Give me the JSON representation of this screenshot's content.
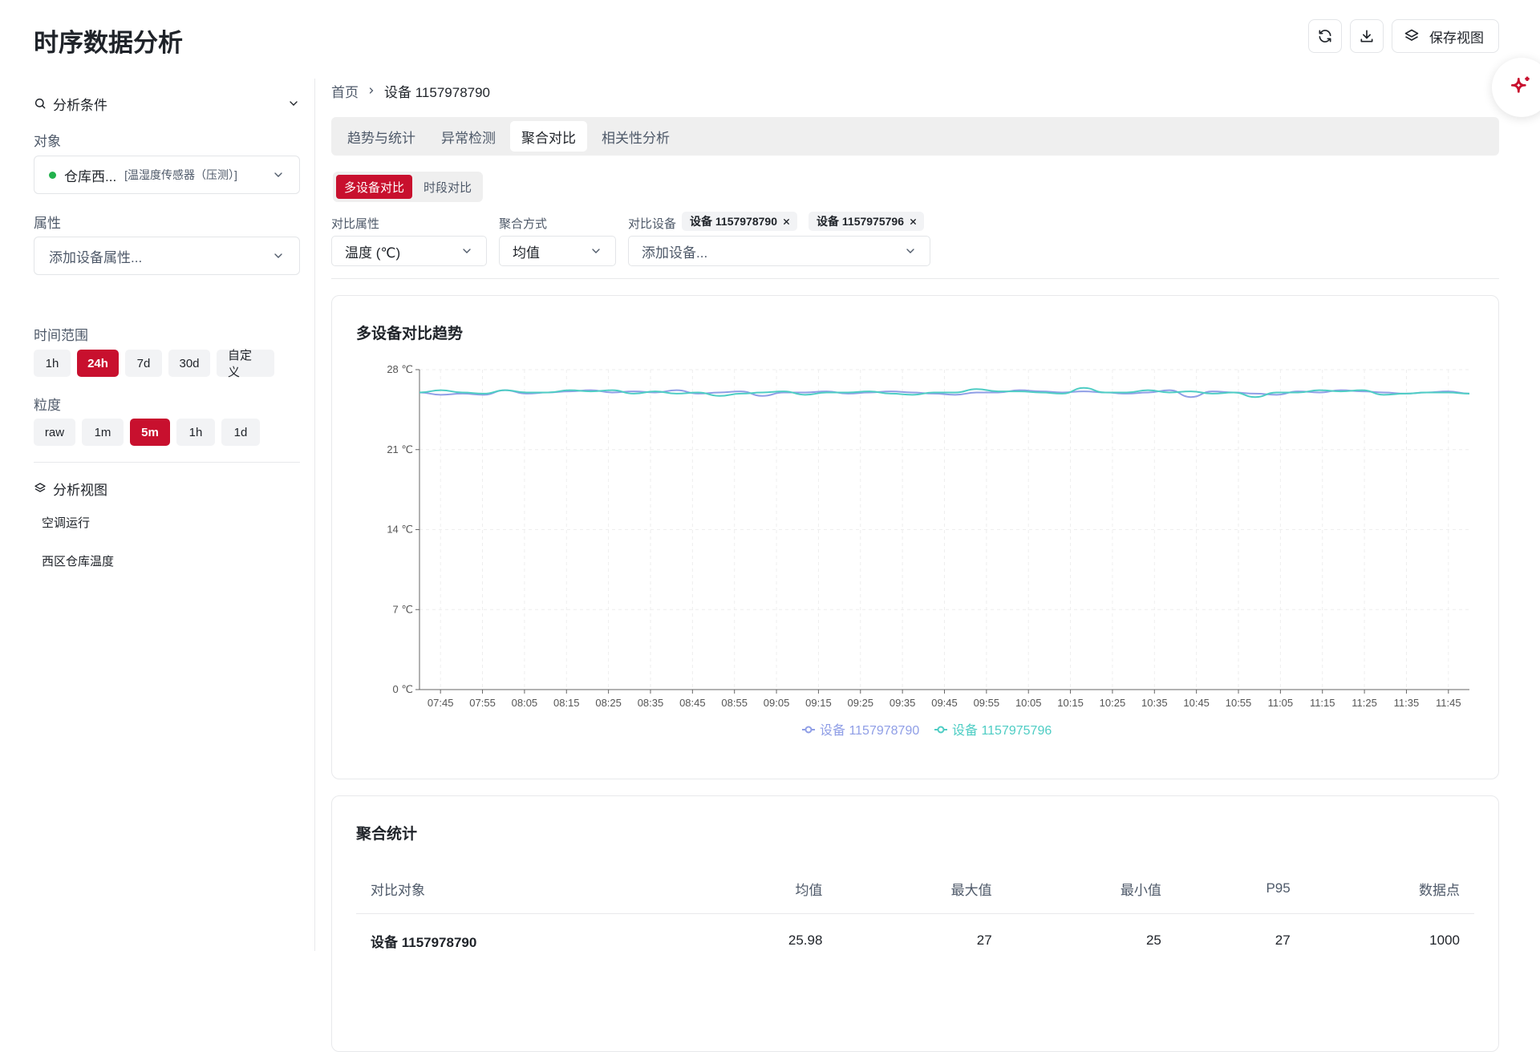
{
  "app": {
    "title": "时序数据分析"
  },
  "top_actions": {
    "save_view_label": "保存视图"
  },
  "sidebar": {
    "analysis_conditions_label": "分析条件",
    "object_label": "对象",
    "object_value": "仓库西...",
    "object_type": "[温湿度传感器（压测）]",
    "object_status_color": "#22b14c",
    "attribute_label": "属性",
    "attribute_placeholder": "添加设备属性...",
    "time_range_label": "时间范围",
    "time_ranges": [
      "1h",
      "24h",
      "7d",
      "30d",
      "自定义"
    ],
    "time_range_active": "24h",
    "granularity_label": "粒度",
    "granularities": [
      "raw",
      "1m",
      "5m",
      "1h",
      "1d"
    ],
    "granularity_active": "5m",
    "analysis_views_label": "分析视图",
    "views": [
      "空调运行",
      "西区仓库温度"
    ]
  },
  "main": {
    "breadcrumb": [
      "首页",
      "设备 1157978790"
    ],
    "tabs": [
      "趋势与统计",
      "异常检测",
      "聚合对比",
      "相关性分析"
    ],
    "active_tab": "聚合对比",
    "compare_modes": [
      "多设备对比",
      "时段对比"
    ],
    "active_compare_mode": "多设备对比",
    "compare_attr_label": "对比属性",
    "compare_attr_value": "温度 (℃)",
    "agg_method_label": "聚合方式",
    "agg_method_value": "均值",
    "compare_devices_label": "对比设备",
    "compare_device_tags": [
      "设备 1157978790",
      "设备 1157975796"
    ],
    "add_device_placeholder": "添加设备..."
  },
  "chart_card": {
    "title": "多设备对比趋势"
  },
  "chart_data": {
    "type": "line",
    "title": "多设备对比趋势",
    "ylim": [
      0,
      28
    ],
    "yticks": [
      0,
      7,
      14,
      21,
      28
    ],
    "y_unit": "℃",
    "x_tick_labels": [
      "07:45",
      "07:55",
      "08:05",
      "08:15",
      "08:25",
      "08:35",
      "08:45",
      "08:55",
      "09:05",
      "09:15",
      "09:25",
      "09:35",
      "09:45",
      "09:55",
      "10:05",
      "10:15",
      "10:25",
      "10:35",
      "10:45",
      "10:55",
      "11:05",
      "11:15",
      "11:25",
      "11:35",
      "11:45"
    ],
    "grid": true,
    "legend_position": "bottom-center",
    "series": [
      {
        "name": "设备 1157978790",
        "color": "#8f9ee6",
        "values": [
          26.0,
          25.8,
          25.9,
          25.8,
          26.2,
          25.9,
          26.0,
          26.1,
          26.2,
          26.0,
          26.1,
          26.0,
          26.2,
          25.9,
          26.0,
          26.1,
          25.7,
          26.0,
          26.0,
          26.1,
          25.9,
          26.0,
          26.1,
          26.0,
          25.9,
          25.8,
          26.0,
          26.0,
          26.2,
          26.1,
          26.0,
          26.1,
          26.0,
          25.9,
          26.0,
          26.2,
          25.6,
          26.1,
          26.0,
          25.9,
          25.8,
          26.1,
          26.0,
          26.2,
          26.1,
          26.0,
          25.9,
          26.0,
          26.1,
          25.9
        ]
      },
      {
        "name": "设备 1157975796",
        "color": "#4ecdc4",
        "values": [
          26.0,
          26.2,
          26.0,
          25.9,
          26.2,
          26.0,
          26.0,
          26.2,
          26.1,
          26.2,
          25.9,
          26.1,
          25.9,
          26.0,
          25.7,
          25.9,
          26.0,
          26.1,
          25.8,
          26.0,
          26.0,
          26.1,
          25.9,
          25.8,
          26.0,
          26.0,
          26.3,
          26.1,
          26.1,
          26.0,
          25.9,
          26.4,
          26.0,
          26.0,
          26.2,
          26.0,
          26.1,
          25.9,
          26.0,
          25.6,
          26.0,
          26.0,
          26.2,
          26.1,
          26.2,
          25.8,
          25.9,
          26.0,
          26.0,
          25.9
        ]
      }
    ]
  },
  "stats_card": {
    "title": "聚合统计",
    "columns": [
      "对比对象",
      "均值",
      "最大值",
      "最小值",
      "P95",
      "数据点"
    ],
    "rows": [
      [
        "设备 1157978790",
        "25.98",
        "27",
        "25",
        "27",
        "1000"
      ]
    ]
  },
  "colors": {
    "accent": "#c8102e"
  }
}
